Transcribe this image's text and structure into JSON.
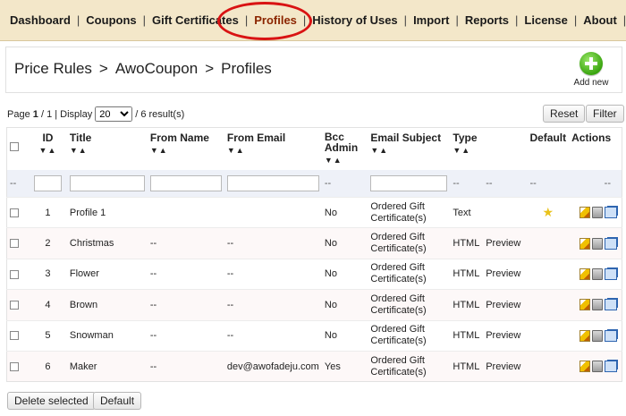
{
  "nav": {
    "items": [
      {
        "label": "Dashboard",
        "active": false
      },
      {
        "label": "Coupons",
        "active": false
      },
      {
        "label": "Gift Certificates",
        "active": false
      },
      {
        "label": "Profiles",
        "active": true
      },
      {
        "label": "History of Uses",
        "active": false
      },
      {
        "label": "Import",
        "active": false
      },
      {
        "label": "Reports",
        "active": false
      },
      {
        "label": "License",
        "active": false
      },
      {
        "label": "About",
        "active": false
      }
    ],
    "separator": "|",
    "highlight_color": "#d91313"
  },
  "breadcrumb": {
    "items": [
      "Price Rules",
      "AwoCoupon",
      "Profiles"
    ],
    "arrow": ">"
  },
  "add_new": {
    "label": "Add new",
    "icon": "plus-circle-icon",
    "color": "#3aa50f"
  },
  "pager": {
    "page_label": "Page",
    "page_current": "1",
    "page_total_text": "/ 1",
    "display_label": "| Display",
    "display_value": "20",
    "results_text": "/ 6 result(s)"
  },
  "buttons": {
    "reset": "Reset",
    "filter": "Filter",
    "delete_selected": "Delete selected",
    "default": "Default"
  },
  "table": {
    "columns": {
      "id": "ID",
      "title": "Title",
      "from_name": "From Name",
      "from_email": "From Email",
      "bcc_admin_1": "Bcc",
      "bcc_admin_2": "Admin",
      "email_subject": "Email Subject",
      "type": "Type",
      "default": "Default",
      "actions": "Actions"
    },
    "sort_glyph": "▼▲",
    "filter_placeholder": "--",
    "rows": [
      {
        "id": "1",
        "title": "Profile 1",
        "from_name": "",
        "from_email": "",
        "bcc": "No",
        "subject_1": "Ordered Gift",
        "subject_2": "Certificate(s)",
        "type": "Text",
        "preview": "",
        "default_star": true
      },
      {
        "id": "2",
        "title": "Christmas",
        "from_name": "--",
        "from_email": "--",
        "bcc": "No",
        "subject_1": "Ordered Gift",
        "subject_2": "Certificate(s)",
        "type": "HTML",
        "preview": "Preview",
        "default_star": false
      },
      {
        "id": "3",
        "title": "Flower",
        "from_name": "--",
        "from_email": "--",
        "bcc": "No",
        "subject_1": "Ordered Gift",
        "subject_2": "Certificate(s)",
        "type": "HTML",
        "preview": "Preview",
        "default_star": false
      },
      {
        "id": "4",
        "title": "Brown",
        "from_name": "--",
        "from_email": "--",
        "bcc": "No",
        "subject_1": "Ordered Gift",
        "subject_2": "Certificate(s)",
        "type": "HTML",
        "preview": "Preview",
        "default_star": false
      },
      {
        "id": "5",
        "title": "Snowman",
        "from_name": "--",
        "from_email": "--",
        "bcc": "No",
        "subject_1": "Ordered Gift",
        "subject_2": "Certificate(s)",
        "type": "HTML",
        "preview": "Preview",
        "default_star": false
      },
      {
        "id": "6",
        "title": "Maker",
        "from_name": "--",
        "from_email": "dev@awofadeju.com",
        "bcc": "Yes",
        "subject_1": "Ordered Gift",
        "subject_2": "Certificate(s)",
        "type": "HTML",
        "preview": "Preview",
        "default_star": false
      }
    ]
  },
  "icons": {
    "star": "★",
    "edit": "edit-icon",
    "trash": "trash-icon",
    "copy": "copy-icon"
  }
}
